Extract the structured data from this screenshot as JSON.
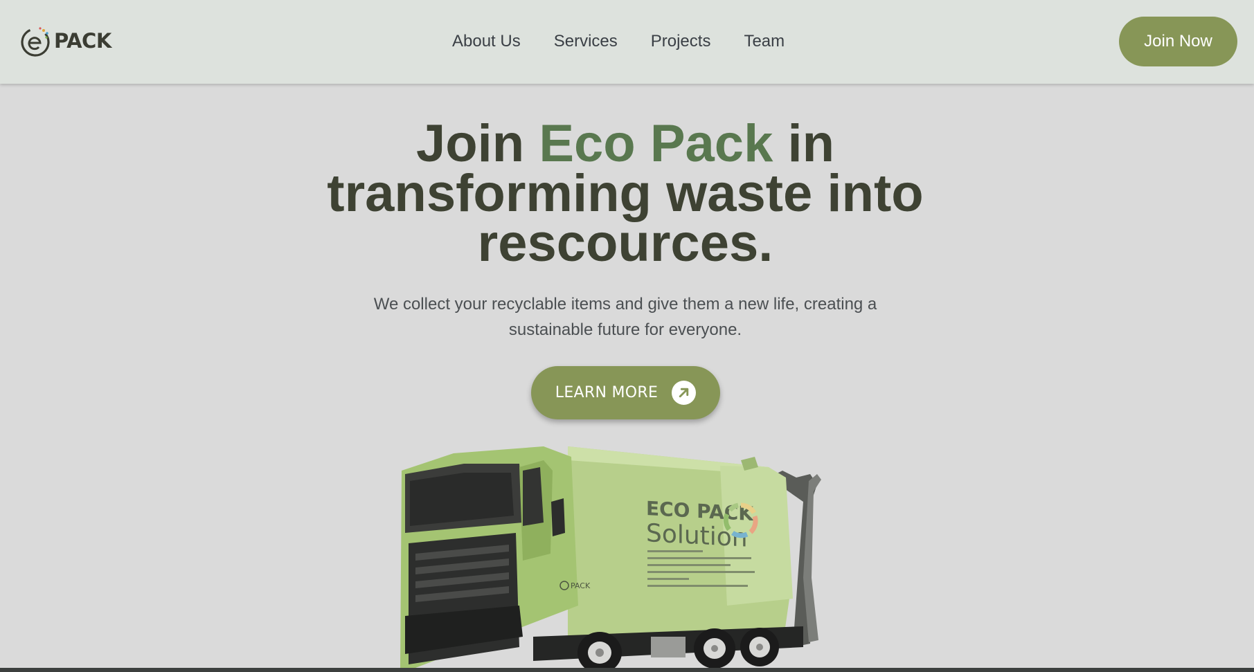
{
  "header": {
    "logo": {
      "text": "PACK",
      "icon": "e-leaf-logo-icon"
    },
    "nav": [
      {
        "label": "About Us"
      },
      {
        "label": "Services"
      },
      {
        "label": "Projects"
      },
      {
        "label": "Team"
      }
    ],
    "join_label": "Join Now"
  },
  "hero": {
    "title_part1": "Join ",
    "title_accent": "Eco Pack",
    "title_part2": " in transforming waste into rescources.",
    "subtitle": "We collect your recyclable items and give them a new life, creating a sustainable future for everyone.",
    "cta_label": "LEARN MORE",
    "cta_icon": "arrow-up-right-icon"
  },
  "truck": {
    "brand_line1": "ECO PACK",
    "brand_line2": "Solution",
    "cab_logo": "PACK"
  },
  "colors": {
    "accent": "#879657",
    "title_accent": "#59784f",
    "title": "#3e4233",
    "header_bg": "#dde2dd",
    "page_bg": "#dadada"
  }
}
